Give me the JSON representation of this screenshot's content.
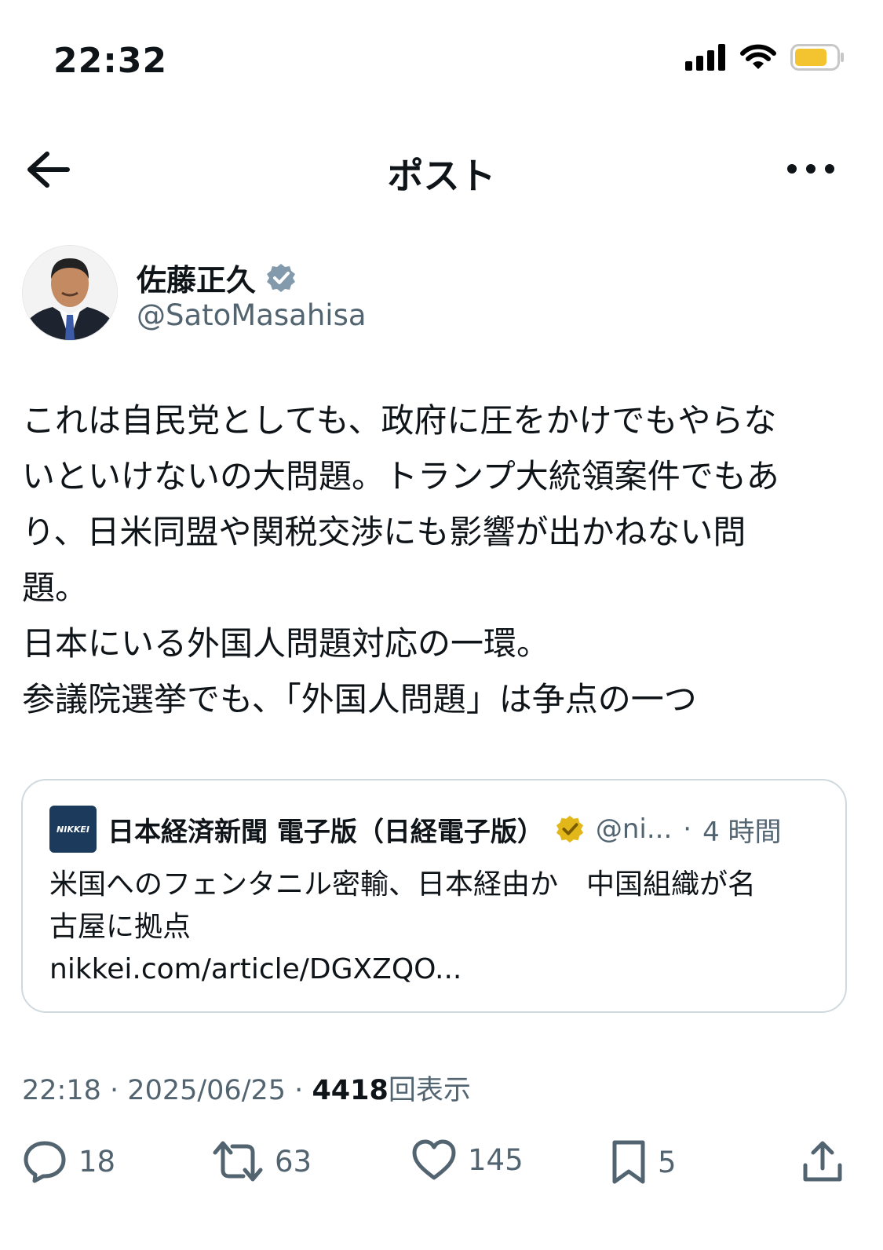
{
  "status_bar": {
    "time": "22:32",
    "battery_color": "#f4c430"
  },
  "nav": {
    "title": "ポスト",
    "back_icon": "arrow-left-icon",
    "more_icon": "more-horizontal-icon"
  },
  "author": {
    "display_name": "佐藤正久",
    "handle": "@SatoMasahisa",
    "verified_badge_color": "#829aab"
  },
  "tweet": {
    "lines": [
      "これは自民党としても、政府に圧をかけでもやらな",
      "いといけないの大問題。トランプ大統領案件でもあ",
      "り、日米同盟や関税交渉にも影響が出かねない問",
      "題。",
      "日本にいる外国人問題対応の一環。",
      "参議院選挙でも、「外国人問題」は争点の一つ"
    ]
  },
  "quote": {
    "logo_text": "NIKKEI",
    "name": "日本経済新聞 電子版（日経電子版）",
    "verified_badge_color": "#e2b719",
    "handle": "@ni...",
    "separator": "·",
    "age": "4 時間",
    "text_lines": [
      "米国へのフェンタニル密輸、日本経由か　中国組織が名",
      "古屋に拠点",
      "nikkei.com/article/DGXZQO..."
    ]
  },
  "meta": {
    "time": "22:18",
    "separator": "·",
    "date": "2025/06/25",
    "views_count": "4418",
    "views_label": "回表示"
  },
  "actions": {
    "replies": "18",
    "reposts": "63",
    "likes": "145",
    "bookmarks": "5"
  }
}
